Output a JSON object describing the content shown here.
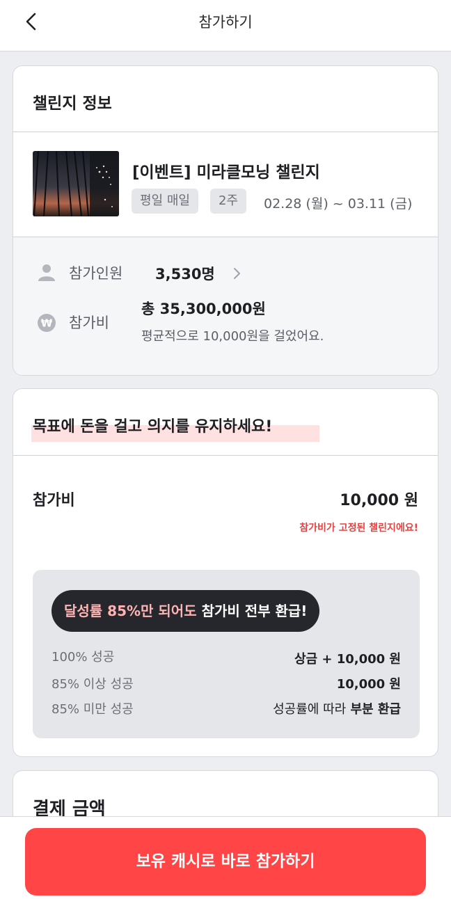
{
  "header": {
    "title": "참가하기"
  },
  "challenge_info": {
    "section_title": "챌린지 정보",
    "name": "[이벤트] 미라클모닝 챌린지",
    "tags": [
      "평일 매일",
      "2주"
    ],
    "period": "02.28 (월) ~ 03.11 (금)",
    "participants_label": "참가인원",
    "participants_value": "3,530명",
    "fee_label": "참가비",
    "fee_total": "총 35,300,000원",
    "fee_average": "평균적으로 10,000원을 걸었어요."
  },
  "fee_section": {
    "headline": "목표에 돈을 걸고 의지를 유지하세요!",
    "label": "참가비",
    "value": "10,000 원",
    "notice": "참가비가 고정된 챌린지에요!",
    "promo_highlight": "달성률 85%만 되어도",
    "promo_rest": "참가비 전부 환급!",
    "refund_rows": [
      {
        "left": "100% 성공",
        "right": "상금 + 10,000 원"
      },
      {
        "left": "85% 이상 성공",
        "right": "10,000 원"
      },
      {
        "left": "85% 미만 성공",
        "right_normal": "성공률에 따라",
        "right_bold": "부분 환급"
      }
    ]
  },
  "payment": {
    "title": "결제 금액"
  },
  "cta": {
    "label": "보유 캐시로 바로 참가하기"
  },
  "colors": {
    "accent": "#ff4545",
    "notice": "#e94040",
    "highlight": "#ffe1e1",
    "pill_bg": "#26272c",
    "pill_pink": "#ffb3b3"
  }
}
